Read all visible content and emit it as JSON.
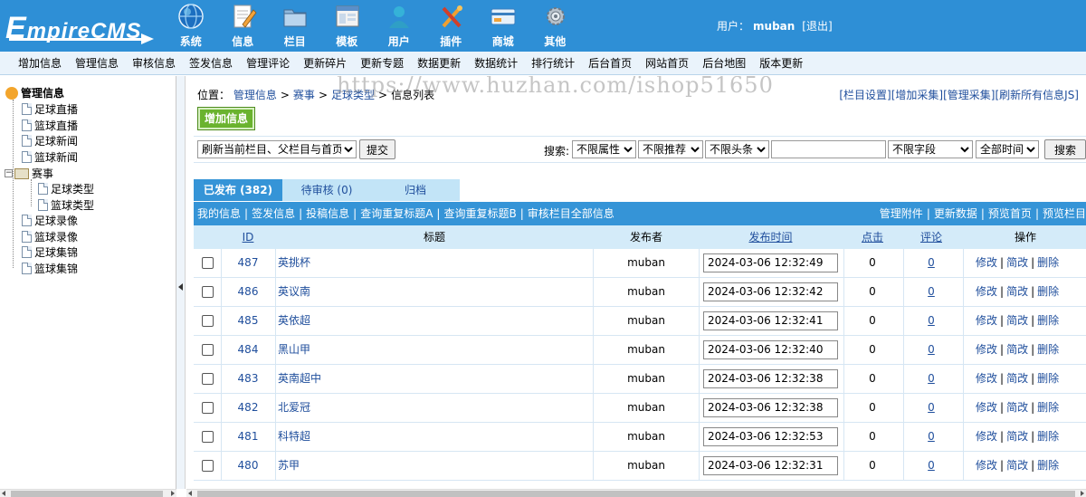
{
  "app": {
    "logo_text": "EmpireCMS",
    "logo_first": "E",
    "logo_rest": "mpireCMS"
  },
  "topnav": [
    {
      "label": "系统",
      "icon": "globe-icon"
    },
    {
      "label": "信息",
      "icon": "edit-note-icon"
    },
    {
      "label": "栏目",
      "icon": "folder-icon"
    },
    {
      "label": "模板",
      "icon": "window-icon"
    },
    {
      "label": "用户",
      "icon": "user-icon"
    },
    {
      "label": "插件",
      "icon": "tools-icon"
    },
    {
      "label": "商城",
      "icon": "card-icon"
    },
    {
      "label": "其他",
      "icon": "gear-icon"
    }
  ],
  "user": {
    "prefix": "用户：",
    "name": "muban",
    "logout": "[退出]"
  },
  "menubar": [
    "增加信息",
    "管理信息",
    "审核信息",
    "签发信息",
    "管理评论",
    "更新碎片",
    "更新专题",
    "数据更新",
    "数据统计",
    "排行统计",
    "后台首页",
    "网站首页",
    "后台地图",
    "版本更新"
  ],
  "tree": {
    "root": "管理信息",
    "items": [
      {
        "label": "足球直播"
      },
      {
        "label": "篮球直播"
      },
      {
        "label": "足球新闻"
      },
      {
        "label": "篮球新闻"
      },
      {
        "label": "赛事"
      },
      {
        "label": "足球类型"
      },
      {
        "label": "篮球类型"
      },
      {
        "label": "足球录像"
      },
      {
        "label": "篮球录像"
      },
      {
        "label": "足球集锦"
      },
      {
        "label": "篮球集锦"
      }
    ]
  },
  "breadcrumb": {
    "prefix": "位置：",
    "parts": [
      "管理信息",
      "赛事",
      "足球类型"
    ],
    "current": "信息列表",
    "separator": ">"
  },
  "watermark": "https://www.huzhan.com/ishop51650",
  "toplinks": [
    "[栏目设置]",
    "[增加采集]",
    "[管理采集]",
    "[刷新所有信息JS]"
  ],
  "add_button": "增加信息",
  "filter": {
    "refresh_option": "刷新当前栏目、父栏目与首页",
    "submit": "提交",
    "search_label": "搜索:",
    "attr": "不限属性",
    "recommend": "不限推荐",
    "headline": "不限头条",
    "search_value": "",
    "field": "不限字段",
    "time": "全部时间",
    "search_button": "搜索"
  },
  "tabs": [
    {
      "label": "已发布 (382)",
      "active": true
    },
    {
      "label": "待审核 (0)",
      "active": false
    },
    {
      "label": "归档",
      "active": false
    }
  ],
  "linkbar": {
    "left": [
      "我的信息",
      "签发信息",
      "投稿信息",
      "查询重复标题A",
      "查询重复标题B",
      "审核栏目全部信息"
    ],
    "right": [
      "管理附件",
      "更新数据",
      "预览首页",
      "预览栏目"
    ]
  },
  "table": {
    "headers": {
      "id": "ID",
      "title": "标题",
      "publisher": "发布者",
      "time": "发布时间",
      "clicks": "点击",
      "comments": "评论",
      "ops": "操作"
    },
    "op_labels": {
      "edit": "修改",
      "quick_edit": "简改",
      "delete": "删除"
    },
    "rows": [
      {
        "id": "487",
        "title": "英挑杯",
        "publisher": "muban",
        "time": "2024-03-06 12:32:49",
        "clicks": "0",
        "comments": "0"
      },
      {
        "id": "486",
        "title": "英议南",
        "publisher": "muban",
        "time": "2024-03-06 12:32:42",
        "clicks": "0",
        "comments": "0"
      },
      {
        "id": "485",
        "title": "英依超",
        "publisher": "muban",
        "time": "2024-03-06 12:32:41",
        "clicks": "0",
        "comments": "0"
      },
      {
        "id": "484",
        "title": "黑山甲",
        "publisher": "muban",
        "time": "2024-03-06 12:32:40",
        "clicks": "0",
        "comments": "0"
      },
      {
        "id": "483",
        "title": "英南超中",
        "publisher": "muban",
        "time": "2024-03-06 12:32:38",
        "clicks": "0",
        "comments": "0"
      },
      {
        "id": "482",
        "title": "北爱冠",
        "publisher": "muban",
        "time": "2024-03-06 12:32:38",
        "clicks": "0",
        "comments": "0"
      },
      {
        "id": "481",
        "title": "科特超",
        "publisher": "muban",
        "time": "2024-03-06 12:32:53",
        "clicks": "0",
        "comments": "0"
      },
      {
        "id": "480",
        "title": "苏甲",
        "publisher": "muban",
        "time": "2024-03-06 12:32:31",
        "clicks": "0",
        "comments": "0"
      }
    ]
  },
  "colors": {
    "header_blue": "#2e8fd6",
    "tab_active": "#3594d7",
    "table_head": "#d4ebf9",
    "link": "#1f4e9c",
    "add_green": "#6ab32e"
  }
}
